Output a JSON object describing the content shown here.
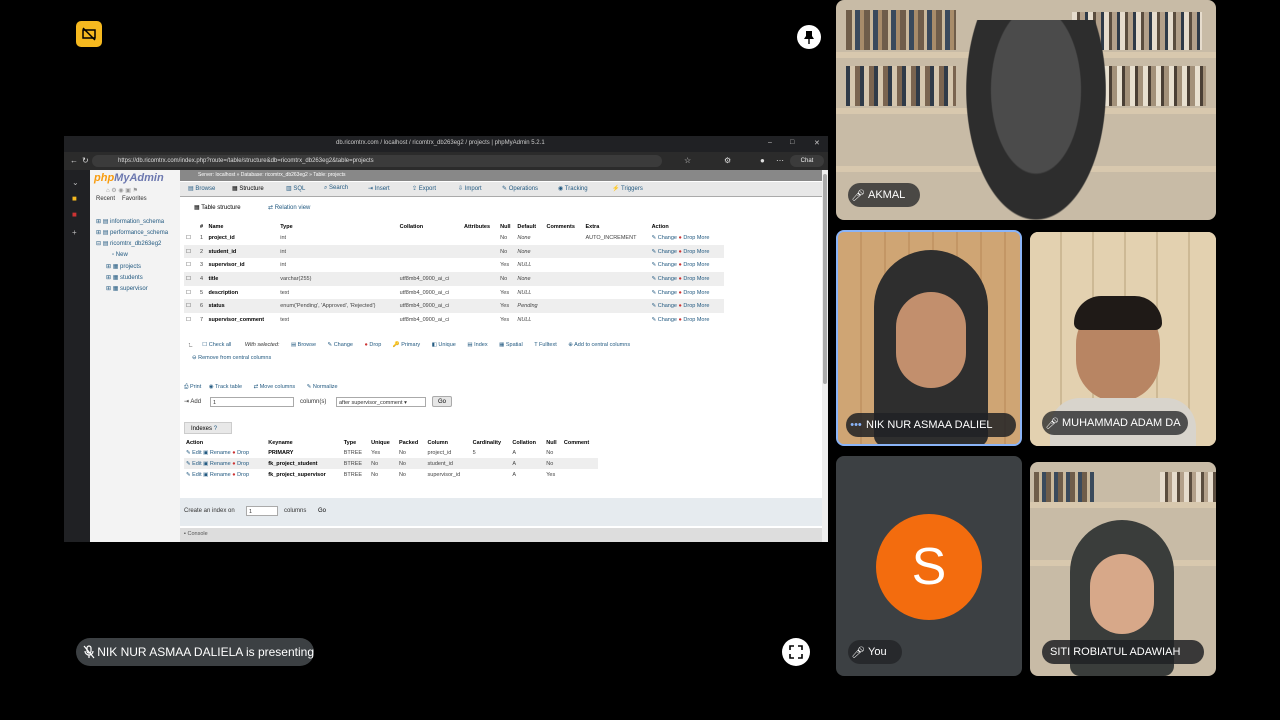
{
  "meeting": {
    "presenting_text": "NIK NUR ASMAA DALIELA is presenting"
  },
  "browser": {
    "window_title": "db.ricomtrx.com / localhost / ricomtrx_db263eg2 / projects | phpMyAdmin 5.2.1",
    "url": "https://db.ricomtrx.com/index.php?route=/table/structure&db=ricomtrx_db263eg2&table=projects",
    "chat_label": "Chat"
  },
  "pma": {
    "logo_a": "php",
    "logo_b": "MyAdmin",
    "nav_links": [
      "Recent",
      "Favorites"
    ],
    "breadcrumb": "Server: localhost  »  Database: ricomtrx_db263eg2  »  Table: projects",
    "tree": [
      "information_schema",
      "performance_schema",
      "ricomtrx_db263eg2",
      "New",
      "projects",
      "students",
      "supervisor"
    ],
    "tabs": [
      "Browse",
      "Structure",
      "SQL",
      "Search",
      "Insert",
      "Export",
      "Import",
      "Operations",
      "Tracking",
      "Triggers"
    ],
    "subtabs": [
      "Table structure",
      "Relation view"
    ],
    "columns_header": [
      "#",
      "Name",
      "Type",
      "Collation",
      "Attributes",
      "Null",
      "Default",
      "Comments",
      "Extra",
      "Action"
    ],
    "columns": [
      {
        "num": "1",
        "name": "project_id",
        "type": "int",
        "collation": "",
        "null": "No",
        "default": "None",
        "extra": "AUTO_INCREMENT"
      },
      {
        "num": "2",
        "name": "student_id",
        "type": "int",
        "collation": "",
        "null": "No",
        "default": "None",
        "extra": ""
      },
      {
        "num": "3",
        "name": "supervisor_id",
        "type": "int",
        "collation": "",
        "null": "Yes",
        "default": "NULL",
        "extra": ""
      },
      {
        "num": "4",
        "name": "title",
        "type": "varchar(255)",
        "collation": "utf8mb4_0900_ai_ci",
        "null": "No",
        "default": "None",
        "extra": ""
      },
      {
        "num": "5",
        "name": "description",
        "type": "text",
        "collation": "utf8mb4_0900_ai_ci",
        "null": "Yes",
        "default": "NULL",
        "extra": ""
      },
      {
        "num": "6",
        "name": "status",
        "type": "enum('Pending', 'Approved', 'Rejected')",
        "collation": "utf8mb4_0900_ai_ci",
        "null": "Yes",
        "default": "Pending",
        "extra": ""
      },
      {
        "num": "7",
        "name": "supervisor_comment",
        "type": "text",
        "collation": "utf8mb4_0900_ai_ci",
        "null": "Yes",
        "default": "NULL",
        "extra": ""
      }
    ],
    "row_actions": {
      "change": "Change",
      "drop": "Drop",
      "more": "More"
    },
    "bulk": {
      "check_all": "Check all",
      "with_selected": "With selected:",
      "actions": [
        "Browse",
        "Change",
        "Drop",
        "Primary",
        "Unique",
        "Index",
        "Spatial",
        "Fulltext",
        "Add to central columns"
      ],
      "remove_central": "Remove from central columns"
    },
    "tools": [
      "Print",
      "Track table",
      "Move columns",
      "Normalize"
    ],
    "add": {
      "label": "Add",
      "count": "1",
      "columns_label": "column(s)",
      "position": "after supervisor_comment",
      "go": "Go"
    },
    "indexes": {
      "title": "Indexes",
      "header": [
        "Action",
        "Keyname",
        "Type",
        "Unique",
        "Packed",
        "Column",
        "Cardinality",
        "Collation",
        "Null",
        "Comment"
      ],
      "actions": {
        "edit": "Edit",
        "rename": "Rename",
        "drop": "Drop"
      },
      "rows": [
        {
          "keyname": "PRIMARY",
          "type": "BTREE",
          "unique": "Yes",
          "packed": "No",
          "column": "project_id",
          "cardinality": "5",
          "collation": "A",
          "null": "No"
        },
        {
          "keyname": "fk_project_student",
          "type": "BTREE",
          "unique": "No",
          "packed": "No",
          "column": "student_id",
          "cardinality": "",
          "collation": "A",
          "null": "No"
        },
        {
          "keyname": "fk_project_supervisor",
          "type": "BTREE",
          "unique": "No",
          "packed": "No",
          "column": "supervisor_id",
          "cardinality": "",
          "collation": "A",
          "null": "Yes"
        }
      ]
    },
    "create_index": {
      "label": "Create an index on",
      "count": "1",
      "columns_label": "columns",
      "go": "Go"
    },
    "console": "Console"
  },
  "participants": {
    "akmal": "AKMAL",
    "nik": "NIK NUR ASMAA DALIEL",
    "adam": "MUHAMMAD ADAM DA",
    "you": "You",
    "you_initial": "S",
    "siti": "SITI ROBIATUL ADAWIAH"
  },
  "colors": {
    "avatar": "#f36c0e",
    "badge": "#f6b91f",
    "chip": "#3c4043",
    "active_border": "#8ab4f8"
  }
}
